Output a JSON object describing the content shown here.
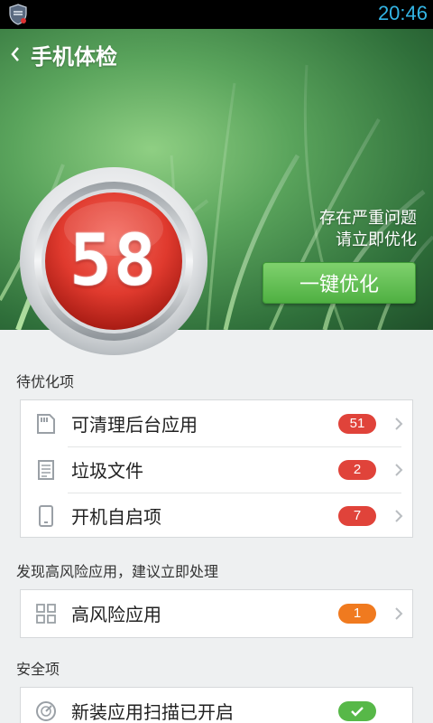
{
  "status_bar": {
    "time": "20:46"
  },
  "header": {
    "title": "手机体检"
  },
  "score": {
    "value": "58"
  },
  "warning": {
    "line1": "存在严重问题",
    "line2": "请立即优化"
  },
  "optimize_button": {
    "label": "一键优化"
  },
  "sections": {
    "pending": {
      "title": "待优化项",
      "items": [
        {
          "label": "可清理后台应用",
          "count": "51"
        },
        {
          "label": "垃圾文件",
          "count": "2"
        },
        {
          "label": "开机自启项",
          "count": "7"
        }
      ]
    },
    "risk": {
      "title": "发现高风险应用，建议立即处理",
      "items": [
        {
          "label": "高风险应用",
          "count": "1"
        }
      ]
    },
    "security": {
      "title": "安全项",
      "items": [
        {
          "label": "新装应用扫描已开启"
        }
      ]
    }
  },
  "colors": {
    "badge_red": "#e0433a",
    "badge_orange": "#f07a1f",
    "badge_green": "#57b848",
    "clock_blue": "#33b5e5"
  },
  "icons": [
    "shield-app-icon",
    "back-icon",
    "sd-card-icon",
    "document-icon",
    "phone-icon",
    "grid-icon",
    "scan-icon",
    "chevron-right-icon",
    "check-icon"
  ]
}
